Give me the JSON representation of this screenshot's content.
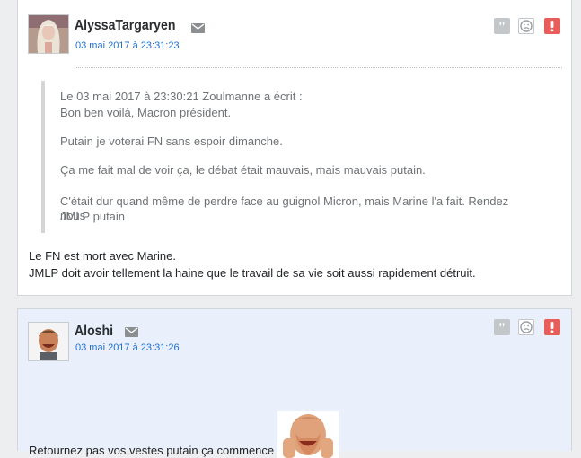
{
  "posts": [
    {
      "pseudo": "AlyssaTargaryen",
      "date": "03 mai 2017 à 23:31:23",
      "avatar_icon": "avatar-blonde-icon",
      "quote": {
        "header": "Le 03 mai 2017 à 23:30:21 Zoulmanne a écrit :",
        "line1": "Bon ben voilà, Macron président.",
        "line2": "Putain je voterai FN sans espoir dimanche.",
        "line3": "Ça me fait mal de voir ça, le débat était mauvais, mais mauvais putain.",
        "line4a": "C'était dur quand même de perdre face au guignol Micron, mais Marine l'a fait. Rendez nous",
        "line4b": "JMLP putain"
      },
      "message": {
        "line1": "Le FN est mort avec Marine.",
        "line2": "JMLP doit avoir tellement la haine que le travail de sa vie soit aussi rapidement détruit."
      }
    },
    {
      "pseudo": "Aloshi",
      "date": "03 mai 2017 à 23:31:26",
      "avatar_icon": "avatar-laughing-man-icon",
      "message": {
        "line1": "Retournez pas vos vestes putain ça commence"
      },
      "sticker": "facepalm-sticker"
    }
  ],
  "colors": {
    "date_link": "#1f6fce",
    "alert_button": "#e85c5a",
    "post2_background": "#e9f0fb"
  }
}
